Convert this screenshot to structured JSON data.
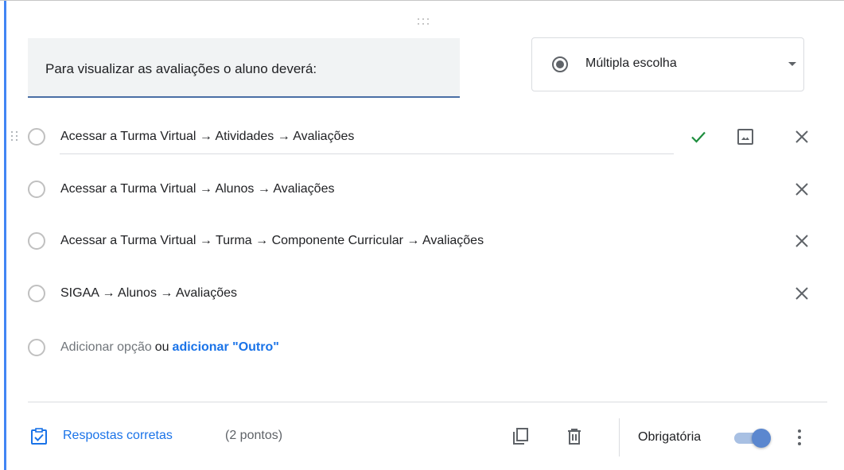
{
  "question": {
    "title": "Para visualizar as avaliações o aluno deverá:"
  },
  "question_type": {
    "selected": "Múltipla escolha",
    "icon": "radio-button-checked-icon"
  },
  "options": [
    {
      "label": "Acessar a Turma Virtual → Atividades → Avaliações",
      "correct": true,
      "focused": true
    },
    {
      "label": "Acessar a Turma Virtual → Alunos → Avaliações"
    },
    {
      "label": "Acessar a Turma Virtual → Turma → Componente Curricular → Avaliações"
    },
    {
      "label": "SIGAA → Alunos → Avaliações"
    }
  ],
  "add_option": {
    "label": "Adicionar opção",
    "or_text": "ou",
    "other_link": "adicionar \"Outro\""
  },
  "footer": {
    "answer_key_label": "Respostas corretas",
    "points": "(2 pontos)",
    "required_label": "Obrigatória",
    "required_on": true
  },
  "colors": {
    "accent": "#1a73e8",
    "check": "#1e8e3e",
    "toggle_track": "#a8c0e3",
    "toggle_knob": "#5b87cf"
  }
}
